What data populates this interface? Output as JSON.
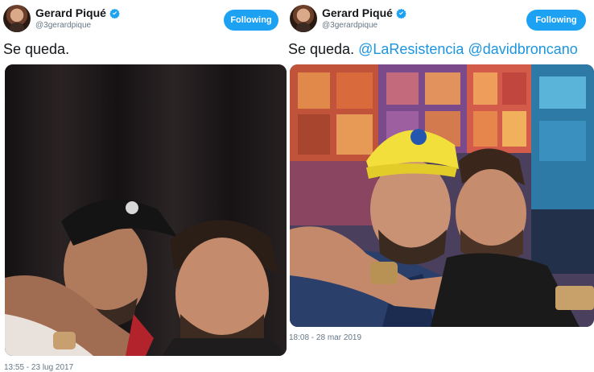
{
  "tweets": [
    {
      "author": {
        "name": "Gerard Piqué",
        "handle": "@3gerardpique",
        "verified": true
      },
      "follow_button_label": "Following",
      "text": "Se queda.",
      "mentions": [],
      "timestamp": "13:55 - 23 lug 2017",
      "photo_description": "selfie"
    },
    {
      "author": {
        "name": "Gerard Piqué",
        "handle": "@3gerardpique",
        "verified": true
      },
      "follow_button_label": "Following",
      "text": "Se queda.",
      "mentions": [
        "@LaResistencia",
        "@davidbroncano"
      ],
      "timestamp": "18:08 - 28 mar 2019",
      "photo_description": "selfie"
    }
  ],
  "icons": {
    "verified": "verified-badge-icon"
  },
  "colors": {
    "accent": "#1da1f2",
    "mention": "#1b95e0",
    "muted": "#657786",
    "text": "#14171a"
  }
}
